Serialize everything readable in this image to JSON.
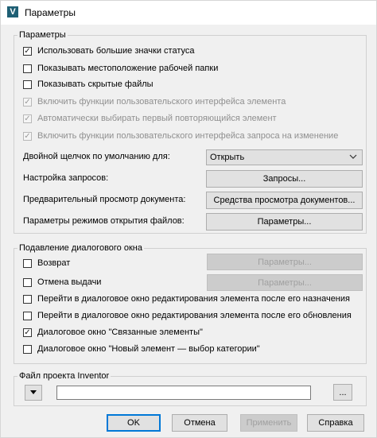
{
  "window": {
    "title": "Параметры",
    "app_icon": "V"
  },
  "params_group": {
    "legend": "Параметры",
    "checkboxes": [
      {
        "label": "Использовать большие значки статуса",
        "checked": true,
        "disabled": false
      },
      {
        "label": "Показывать местоположение рабочей папки",
        "checked": false,
        "disabled": false
      },
      {
        "label": "Показывать скрытые файлы",
        "checked": false,
        "disabled": false
      },
      {
        "label": "Включить функции пользовательского интерфейса элемента",
        "checked": true,
        "disabled": true
      },
      {
        "label": "Автоматически выбирать первый повторяющийся элемент",
        "checked": true,
        "disabled": true
      },
      {
        "label": "Включить функции пользовательского интерфейса запроса на изменение",
        "checked": true,
        "disabled": true
      }
    ],
    "double_click_label": "Двойной щелчок по умолчанию для:",
    "double_click_value": "Открыть",
    "queries_label": "Настройка запросов:",
    "queries_button": "Запросы...",
    "preview_label": "Предварительный просмотр документа:",
    "preview_button": "Средства просмотра документов...",
    "open_modes_label": "Параметры режимов открытия файлов:",
    "open_modes_button": "Параметры..."
  },
  "dialog_group": {
    "legend": "Подавление диалогового окна",
    "checkboxes": [
      {
        "label": "Возврат",
        "checked": false
      },
      {
        "label": "Отмена выдачи",
        "checked": false
      },
      {
        "label": "Перейти в диалоговое окно редактирования элемента после его назначения",
        "checked": false
      },
      {
        "label": "Перейти в диалоговое окно редактирования элемента после его обновления",
        "checked": false
      },
      {
        "label": "Диалоговое окно \"Связанные элементы\"",
        "checked": true
      },
      {
        "label": "Диалоговое окно \"Новый элемент — выбор категории\"",
        "checked": false
      }
    ],
    "return_params_button": "Параметры...",
    "cancel_params_button": "Параметры..."
  },
  "inventor_group": {
    "legend": "Файл проекта Inventor",
    "path_value": "",
    "browse_button": "..."
  },
  "footer": {
    "ok": "OK",
    "cancel": "Отмена",
    "apply": "Применить",
    "help": "Справка"
  },
  "colors": {
    "accent": "#0078d7",
    "app_icon": "#1e5f74"
  }
}
